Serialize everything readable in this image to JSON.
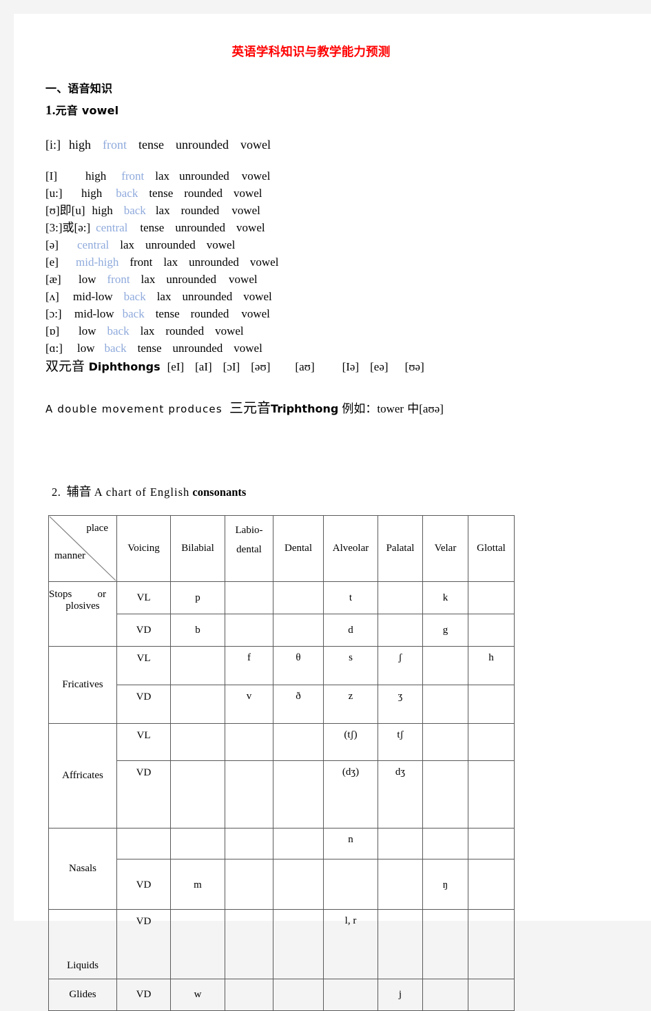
{
  "document": {
    "title": "英语学科知识与教学能力预测",
    "title_color": "#ff0000",
    "accent_blue": "#8faadc"
  },
  "section1": {
    "heading": "一、语音知识",
    "subheading_num": "1.",
    "subheading_text": "元音 vowel"
  },
  "vowels": {
    "first": {
      "symbol": "[i:]",
      "words": [
        "high",
        "front",
        "tense",
        "unrounded",
        "vowel"
      ],
      "blue_index": 1
    },
    "rows": [
      {
        "symbol": "[I]",
        "words": [
          "high",
          "front",
          "lax",
          "unrounded",
          "vowel"
        ],
        "blue_index": 1
      },
      {
        "symbol": "[u:]",
        "words": [
          "high",
          "back",
          "tense",
          "rounded",
          "vowel"
        ],
        "blue_index": 1
      },
      {
        "symbol": "[ʊ]即[u]",
        "words": [
          "high",
          "back",
          "lax",
          "rounded",
          "vowel"
        ],
        "blue_index": 1
      },
      {
        "symbol": "[3:]或[ə:]",
        "words": [
          "central",
          "tense",
          "unrounded",
          "vowel"
        ],
        "blue_index": 0
      },
      {
        "symbol": "[ə]",
        "words": [
          "central",
          "lax",
          "unrounded",
          "vowel"
        ],
        "blue_index": 0
      },
      {
        "symbol": "[e]",
        "words": [
          "mid-high",
          "front",
          "lax",
          "unrounded",
          "vowel"
        ],
        "blue_index": 0
      },
      {
        "symbol": "[æ]",
        "words": [
          "low",
          "front",
          "lax",
          "unrounded",
          "vowel"
        ],
        "blue_index": 1
      },
      {
        "symbol": "[ʌ]",
        "words": [
          "mid-low",
          "back",
          "lax",
          "unrounded",
          "vowel"
        ],
        "blue_index": 1
      },
      {
        "symbol": "[ɔ:]",
        "words": [
          "mid-low",
          "back",
          "tense",
          "rounded",
          "vowel"
        ],
        "blue_index": 1
      },
      {
        "symbol": "[ɒ]",
        "words": [
          "low",
          "back",
          "lax",
          "rounded",
          "vowel"
        ],
        "blue_index": 1
      },
      {
        "symbol": "[ɑ:]",
        "words": [
          "low",
          "back",
          "tense",
          "unrounded",
          "vowel"
        ],
        "blue_index": 1
      }
    ]
  },
  "diphthongs": {
    "label_cn": "双元音",
    "label_en": "Diphthongs",
    "items": [
      "[eI]",
      "[aI]",
      "[ɔI]",
      "[əʊ]",
      "[aʊ]",
      "[Iə]",
      "[eə]",
      "[ʊə]"
    ]
  },
  "triphthong": {
    "lead": "A double movement produces",
    "label_cn": "三元音",
    "label_en": "Triphthong",
    "example_cn": "例如：",
    "example_word": "tower",
    "example_mid": "中",
    "example_sym": "[aʊə]"
  },
  "section2": {
    "index": "2.",
    "cn": "辅音",
    "mid": "A chart of English",
    "bold": "consonants"
  },
  "table": {
    "corner": {
      "place": "place",
      "manner": "manner"
    },
    "columns": [
      "Voicing",
      "Bilabial",
      "Labio-dental",
      "Dental",
      "Alveolar",
      "Palatal",
      "Velar",
      "Glottal"
    ],
    "col_labio_line1": "Labio-",
    "col_labio_line2": "dental",
    "rows": [
      {
        "label_a": "Stops",
        "label_b": "or",
        "label_c": "plosives",
        "subrows": [
          {
            "voicing": "VL",
            "cells": [
              "p",
              "",
              "",
              "t",
              "",
              "k",
              ""
            ]
          },
          {
            "voicing": "VD",
            "cells": [
              "b",
              "",
              "",
              "d",
              "",
              "g",
              ""
            ]
          }
        ]
      },
      {
        "label_a": "Fricatives",
        "label_b": "",
        "label_c": "",
        "subrows": [
          {
            "voicing": "VL",
            "cells": [
              "",
              "f",
              "θ",
              "s",
              "ʃ",
              "",
              "h"
            ]
          },
          {
            "voicing": "VD",
            "cells": [
              "",
              "v",
              "ð",
              "z",
              "ʒ",
              "",
              ""
            ]
          }
        ]
      },
      {
        "label_a": "Affricates",
        "label_b": "",
        "label_c": "",
        "subrows": [
          {
            "voicing": "VL",
            "cells": [
              "",
              "",
              "",
              "(tʃ)",
              "tʃ",
              "",
              ""
            ]
          },
          {
            "voicing": "VD",
            "cells": [
              "",
              "",
              "",
              "(dʒ)",
              "dʒ",
              "",
              ""
            ]
          }
        ]
      },
      {
        "label_a": "Nasals",
        "label_b": "",
        "label_c": "",
        "subrows": [
          {
            "voicing": "",
            "cells": [
              "",
              "",
              "",
              "n",
              "",
              "",
              ""
            ]
          },
          {
            "voicing": "VD",
            "cells": [
              "m",
              "",
              "",
              "",
              "",
              "ŋ",
              ""
            ]
          }
        ]
      },
      {
        "label_a": "Liquids",
        "label_b": "",
        "label_c": "",
        "subrows": [
          {
            "voicing": "VD",
            "cells": [
              "",
              "",
              "",
              "l, r",
              "",
              "",
              ""
            ]
          }
        ]
      },
      {
        "label_a": "Glides",
        "label_b": "",
        "label_c": "",
        "subrows": [
          {
            "voicing": "VD",
            "cells": [
              "w",
              "",
              "",
              "",
              "j",
              "",
              ""
            ]
          }
        ]
      }
    ]
  }
}
